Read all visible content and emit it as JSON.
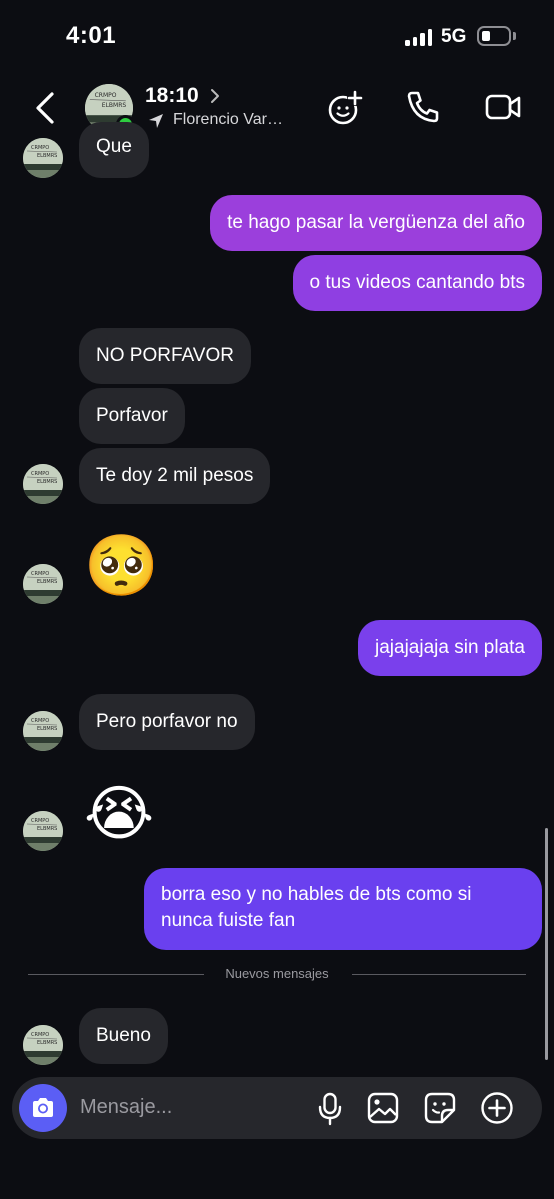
{
  "status_bar": {
    "time": "4:01",
    "network": "5G",
    "battery_level": 0.25
  },
  "header": {
    "contact_name": "18:10",
    "contact_location": "Florencio Var…",
    "icons": [
      "back-chevron-icon",
      "chevron-right-icon",
      "location-arrow-icon",
      "effects-icon",
      "phone-icon",
      "video-camera-icon"
    ]
  },
  "messages": [
    {
      "direction": "in",
      "text": "Que"
    },
    {
      "direction": "out",
      "text": "te hago pasar la vergüenza del año"
    },
    {
      "direction": "out",
      "text": "o tus videos cantando bts"
    },
    {
      "direction": "in",
      "text": "NO PORFAVOR"
    },
    {
      "direction": "in",
      "text": "Porfavor"
    },
    {
      "direction": "in",
      "text": "Te doy 2 mil pesos"
    },
    {
      "direction": "in",
      "text": "🥺"
    },
    {
      "direction": "out",
      "text": "jajajajaja sin plata"
    },
    {
      "direction": "in",
      "text": "Pero porfavor no"
    },
    {
      "direction": "in",
      "text": "😭"
    },
    {
      "direction": "out",
      "text": "borra eso y no hables de bts como si\nnunca fuiste fan"
    },
    {
      "direction": "in",
      "text": "Bueno"
    }
  ],
  "divider": {
    "label": "Nuevos mensajes"
  },
  "composer": {
    "placeholder": "Mensaje...",
    "icons": [
      "camera-icon",
      "microphone-icon",
      "gallery-icon",
      "sticker-icon",
      "plus-icon"
    ]
  },
  "colors": {
    "background": "#0c0d12",
    "incoming_bubble": "#26272c",
    "outgoing_purple": "#9b3fdc",
    "outgoing_violet": "#6a40ef",
    "camera_button": "#5b5ef5",
    "online_dot": "#2ecc40"
  }
}
